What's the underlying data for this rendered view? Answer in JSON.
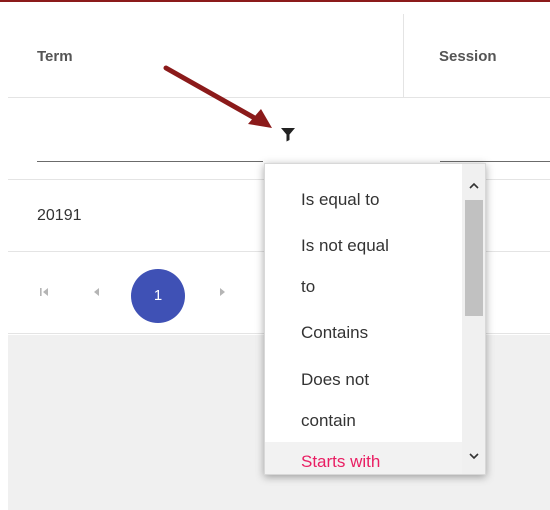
{
  "header": {
    "columns": [
      "Term",
      "Session"
    ]
  },
  "rows": [
    {
      "term": "20191"
    }
  ],
  "pager": {
    "current_page": "1"
  },
  "filter_menu": {
    "options": [
      {
        "label": "Is equal to"
      },
      {
        "label": "Is not equal"
      },
      {
        "label": "to"
      },
      {
        "label": "Contains"
      },
      {
        "label": "Does not"
      },
      {
        "label": "contain"
      },
      {
        "label": "Starts with"
      }
    ]
  },
  "colors": {
    "accent": "#3f51b5",
    "highlight": "#e91e63",
    "annotation_arrow": "#8b1a1a"
  }
}
